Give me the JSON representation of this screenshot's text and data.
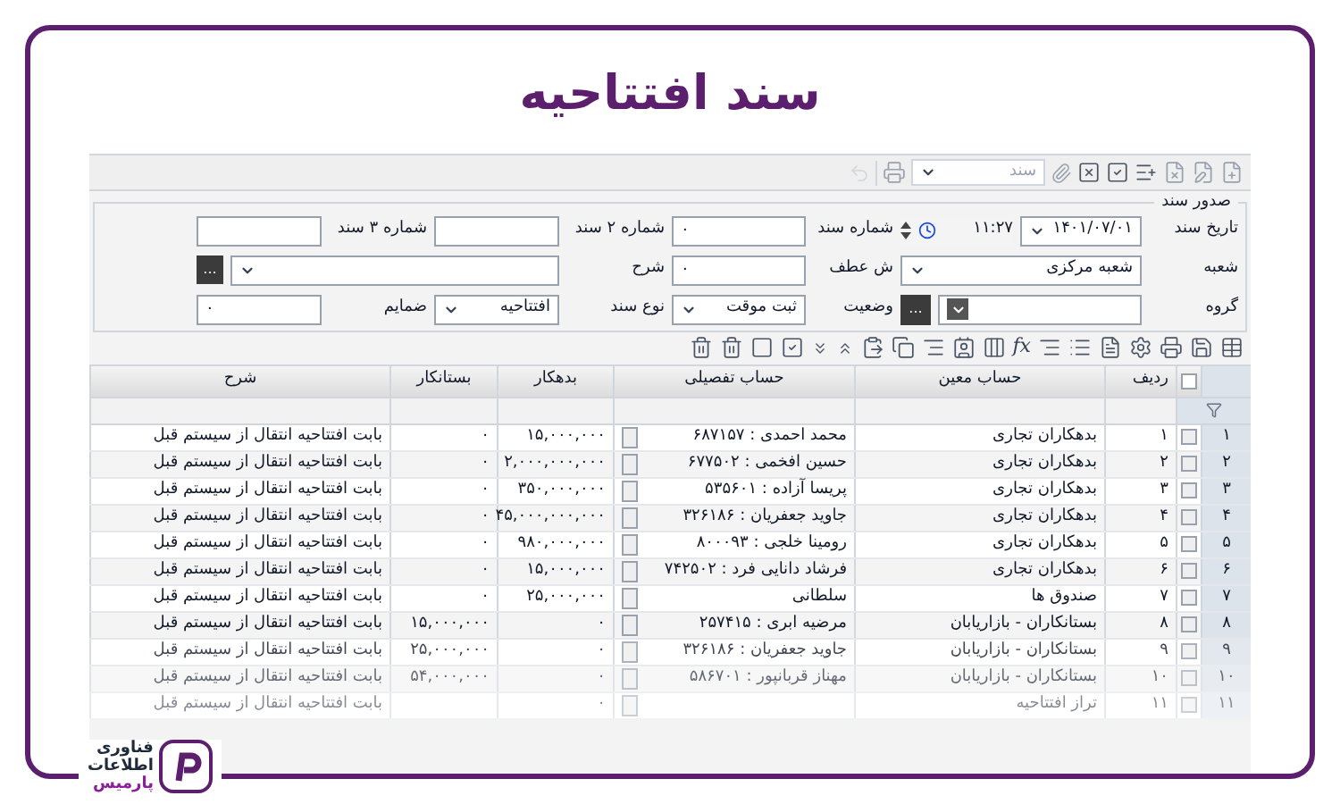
{
  "title": "سند افتتاحیه",
  "toolbar": {
    "document_select": "سند"
  },
  "form": {
    "legend": "صدور سند",
    "rows": [
      [
        {
          "label": "تاریخ سند",
          "kind": "datetime",
          "value": "۱۴۰۱/۰۷/۰۱",
          "time": "۱۱:۲۷"
        },
        {
          "label": "شماره سند",
          "kind": "text",
          "value": "۰"
        },
        {
          "label": "شماره ۲ سند",
          "kind": "text"
        },
        {
          "label": "شماره ۳ سند",
          "kind": "text"
        }
      ],
      [
        {
          "label": "شعبه",
          "kind": "select",
          "value": "شعبه مرکزی"
        },
        {
          "label": "ش عطف",
          "kind": "text",
          "value": "۰"
        },
        {
          "label": "شرح",
          "kind": "wide_lookup",
          "button": "..."
        }
      ],
      [
        {
          "label": "گروه",
          "kind": "combo_lookup",
          "button": "..."
        },
        {
          "label": "وضعیت",
          "kind": "select",
          "value": "ثبت موقت"
        },
        {
          "label": "نوع سند",
          "kind": "select",
          "value": "افتتاحیه"
        },
        {
          "label": "ضمایم",
          "kind": "text",
          "value": "۰"
        }
      ]
    ]
  },
  "table_toolbar": {
    "formula_button": "fx"
  },
  "table": {
    "header_checked": false,
    "columns": [
      "ردیف",
      "حساب معین",
      "حساب تفصیلی",
      "بدهکار",
      "بستانکار",
      "شرح"
    ],
    "rows": [
      {
        "number": "۱",
        "checked": false,
        "radif": "۱",
        "moein": "بدهکاران تجاری",
        "tafsili": "محمد احمدی : ۶۸۷۱۵۷",
        "debit": "۱۵,۰۰۰,۰۰۰",
        "credit": "۰",
        "sharh": "بابت افتتاحیه انتقال از سیستم قبل"
      },
      {
        "number": "۲",
        "checked": false,
        "radif": "۲",
        "moein": "بدهکاران تجاری",
        "tafsili": "حسین افخمی : ۶۷۷۵۰۲",
        "debit": "۲,۰۰۰,۰۰۰,۰۰۰",
        "credit": "۰",
        "sharh": "بابت افتتاحیه انتقال از سیستم قبل"
      },
      {
        "number": "۳",
        "checked": false,
        "radif": "۳",
        "moein": "بدهکاران تجاری",
        "tafsili": "پریسا آزاده : ۵۳۵۶۰۱",
        "debit": "۳۵۰,۰۰۰,۰۰۰",
        "credit": "۰",
        "sharh": "بابت افتتاحیه انتقال از سیستم قبل"
      },
      {
        "number": "۴",
        "checked": false,
        "radif": "۴",
        "moein": "بدهکاران تجاری",
        "tafsili": "جاوید جعفریان : ۳۲۶۱۸۶",
        "debit": "۴۵,۰۰۰,۰۰۰,۰۰۰",
        "credit": "۰",
        "sharh": "بابت افتتاحیه انتقال از سیستم قبل"
      },
      {
        "number": "۵",
        "checked": false,
        "radif": "۵",
        "moein": "بدهکاران تجاری",
        "tafsili": "رومینا خلجی : ۸۰۰۰۹۳",
        "debit": "۹۸۰,۰۰۰,۰۰۰",
        "credit": "۰",
        "sharh": "بابت افتتاحیه انتقال از سیستم قبل"
      },
      {
        "number": "۶",
        "checked": false,
        "radif": "۶",
        "moein": "بدهکاران تجاری",
        "tafsili": "فرشاد دانایی فرد : ۷۴۲۵۰۲",
        "debit": "۱۵,۰۰۰,۰۰۰",
        "credit": "۰",
        "sharh": "بابت افتتاحیه انتقال از سیستم قبل"
      },
      {
        "number": "۷",
        "checked": false,
        "radif": "۷",
        "moein": "صندوق ها",
        "tafsili": "سلطانی",
        "debit": "۲۵,۰۰۰,۰۰۰",
        "credit": "۰",
        "sharh": "بابت افتتاحیه انتقال از سیستم قبل"
      },
      {
        "number": "۸",
        "checked": false,
        "radif": "۸",
        "moein": "بستانکاران - بازاریابان",
        "tafsili": "مرضیه ابری : ۲۵۷۴۱۵",
        "debit": "۰",
        "credit": "۱۵,۰۰۰,۰۰۰",
        "sharh": "بابت افتتاحیه انتقال از سیستم قبل"
      },
      {
        "number": "۹",
        "checked": false,
        "radif": "۹",
        "moein": "بستانکاران - بازاریابان",
        "tafsili": "جاوید جعفریان : ۳۲۶۱۸۶",
        "debit": "۰",
        "credit": "۲۵,۰۰۰,۰۰۰",
        "sharh": "بابت افتتاحیه انتقال از سیستم قبل"
      },
      {
        "number": "۱۰",
        "checked": false,
        "radif": "۱۰",
        "moein": "بستانکاران - بازاریابان",
        "tafsili": "مهناز قربانپور : ۵۸۶۷۰۱",
        "debit": "۰",
        "credit": "۵۴,۰۰۰,۰۰۰",
        "sharh": "بابت افتتاحیه انتقال از سیستم قبل"
      },
      {
        "number": "۱۱",
        "checked": false,
        "radif": "۱۱",
        "moein": "تراز افتتاحیه",
        "debit": "۰",
        "sharh": "بابت افتتاحیه انتقال از سیستم قبل"
      }
    ]
  },
  "logo": [
    "فناوری",
    "اطلاعات",
    "پارمیس"
  ]
}
